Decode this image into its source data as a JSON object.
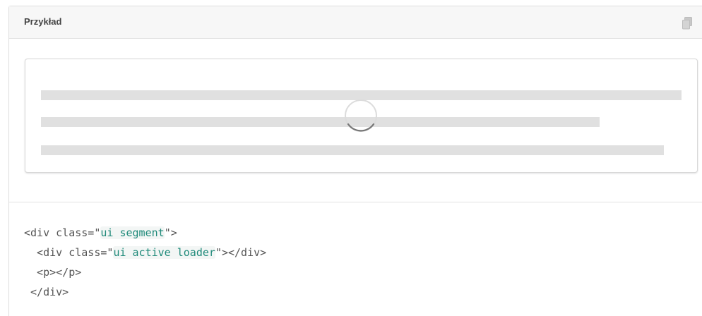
{
  "example": {
    "title": "Przykład"
  },
  "icons": {
    "copy": "copy-icon"
  },
  "colors": {
    "header_bg": "#f7f7f7",
    "placeholder_line": "#e0e0e0",
    "code_text": "#555555",
    "code_string": "#1f8a7a"
  },
  "code": {
    "line1": {
      "pre": "<div class=\"",
      "str": "ui segment",
      "post": "\">"
    },
    "line2": {
      "pre": "  <div class=\"",
      "str": "ui active loader",
      "post": "\"></div>"
    },
    "line3": {
      "text": "  <p></p>"
    },
    "line4": {
      "text": " </div>"
    }
  }
}
